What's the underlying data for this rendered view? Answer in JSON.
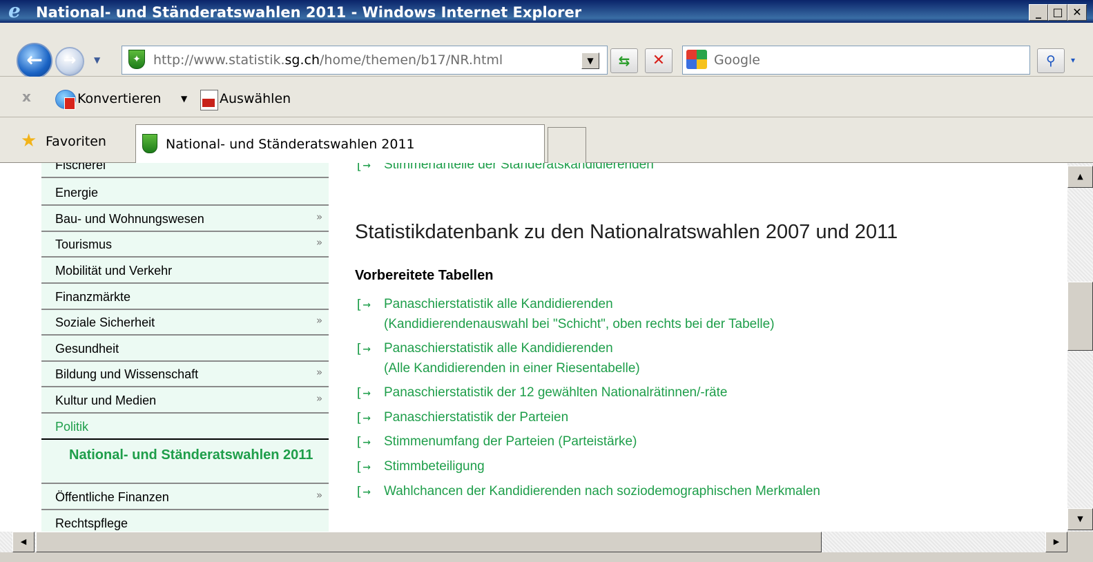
{
  "window": {
    "title": "National- und Ständeratswahlen 2011 - Windows Internet Explorer",
    "minimize": "_",
    "maximize": "□",
    "close": "✕"
  },
  "navbar": {
    "back_icon": "←",
    "forward_icon": "→",
    "dropdown_icon": "▼",
    "url_pre": "http://www.statistik.",
    "url_domain": "sg.ch",
    "url_post": "/home/themen/b17/NR.html",
    "address_dropdown_icon": "▼",
    "refresh_icon": "⇆",
    "stop_icon": "✕",
    "search_placeholder": "Google",
    "search_icon": "⚲",
    "search_dropdown_icon": "▾",
    "accent_color": "#1e9e4a"
  },
  "commandbar": {
    "close_icon": "x",
    "convert_label": "Konvertieren",
    "convert_dropdown_icon": "▼",
    "select_label": "Auswählen"
  },
  "favoritesbar": {
    "favorites_label": "Favoriten",
    "star_icon": "★",
    "tab_label": "National- und Ständeratswahlen 2011"
  },
  "sidebar": {
    "items": [
      {
        "label": "Fischerei",
        "arrow": ""
      },
      {
        "label": "Energie",
        "arrow": ""
      },
      {
        "label": "Bau- und Wohnungswesen",
        "arrow": "»"
      },
      {
        "label": "Tourismus",
        "arrow": "»"
      },
      {
        "label": "Mobilität und Verkehr",
        "arrow": ""
      },
      {
        "label": "Finanzmärkte",
        "arrow": ""
      },
      {
        "label": "Soziale Sicherheit",
        "arrow": "»"
      },
      {
        "label": "Gesundheit",
        "arrow": ""
      },
      {
        "label": "Bildung und Wissenschaft",
        "arrow": "»"
      },
      {
        "label": "Kultur und Medien",
        "arrow": "»"
      },
      {
        "label": "Politik",
        "arrow": ""
      }
    ],
    "sub_item": "National- und Ständeratswahlen 2011",
    "after_items": [
      {
        "label": "Öffentliche Finanzen",
        "arrow": "»"
      },
      {
        "label": "Rechtspflege",
        "arrow": ""
      }
    ]
  },
  "main": {
    "top_link": "Stimmenanteile der Ständeratskandidierenden",
    "arrow_glyph": "[→",
    "heading": "Statistikdatenbank zu den Nationalratswahlen 2007 und 2011",
    "subheading": "Vorbereitete Tabellen",
    "links": [
      {
        "text": "Panaschierstatistik alle Kandidierenden",
        "sub": "(Kandidierendenauswahl bei \"Schicht\", oben rechts bei der Tabelle)"
      },
      {
        "text": "Panaschierstatistik alle Kandidierenden",
        "sub": "(Alle Kandidierenden in einer Riesentabelle)"
      },
      {
        "text": "Panaschierstatistik der 12 gewählten Nationalrätinnen/-räte",
        "sub": ""
      },
      {
        "text": "Panaschierstatistik der Parteien",
        "sub": ""
      },
      {
        "text": "Stimmenumfang der Parteien (Parteistärke)",
        "sub": ""
      },
      {
        "text": "Stimmbeteiligung",
        "sub": ""
      },
      {
        "text": "Wahlchancen der Kandidierenden nach soziodemographischen Merkmalen",
        "sub": ""
      }
    ]
  },
  "scrollbars": {
    "up_icon": "▲",
    "down_icon": "▼",
    "left_icon": "◀",
    "right_icon": "▶"
  }
}
